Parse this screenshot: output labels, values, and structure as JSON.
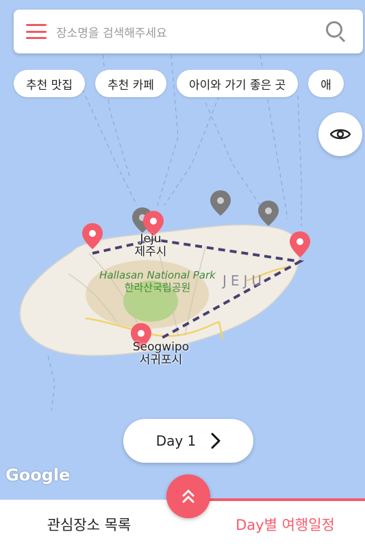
{
  "search": {
    "placeholder": "장소명을 검색해주세요"
  },
  "chips": [
    "추천 맛집",
    "추천 카페",
    "아이와 가기 좋은 곳",
    "애"
  ],
  "map": {
    "places": [
      {
        "name_en": "Jeju",
        "name_ko": "제주시"
      },
      {
        "name_en": "Seogwipo",
        "name_ko": "서귀포시"
      }
    ],
    "park": {
      "name_en": "Hallasan National Park",
      "name_ko": "한라산국립공원"
    },
    "region": "JEJU",
    "google_logo": "Google"
  },
  "day_selector": {
    "label": "Day 1"
  },
  "tabs": {
    "favorites": "관심장소 목록",
    "daily": "Day별 여행일정"
  },
  "colors": {
    "accent": "#f45b6b",
    "route": "#4a3f6e",
    "marker_gray": "#7a7a7a"
  },
  "icons": {
    "menu": "menu-icon",
    "search": "search-icon",
    "eye": "eye-icon",
    "chevron_right": "chevron-right-icon",
    "chevrons_up": "chevrons-up-icon",
    "pin": "map-pin-icon"
  }
}
